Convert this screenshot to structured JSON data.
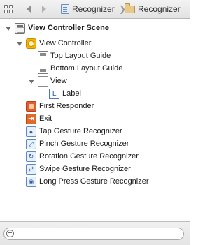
{
  "navbar": {
    "breadcrumbs": [
      {
        "label": "Recognizer",
        "icon": "project-file-icon"
      },
      {
        "label": "Recognizer",
        "icon": "folder-icon"
      }
    ],
    "chevron": "❯"
  },
  "outline": {
    "items": [
      {
        "label": "View Controller Scene",
        "icon": "scene-icon",
        "bold": true,
        "expanded": true,
        "level": 0
      },
      {
        "label": "View Controller",
        "icon": "view-controller-icon",
        "bold": false,
        "expanded": true,
        "level": 1
      },
      {
        "label": "Top Layout Guide",
        "icon": "top-layout-guide-icon",
        "level": 2
      },
      {
        "label": "Bottom Layout Guide",
        "icon": "bottom-layout-guide-icon",
        "level": 2
      },
      {
        "label": "View",
        "icon": "view-icon",
        "expanded": true,
        "level": 2
      },
      {
        "label": "Label",
        "icon": "label-icon",
        "glyph": "L",
        "level": 3
      },
      {
        "label": "First Responder",
        "icon": "first-responder-icon",
        "level": 1
      },
      {
        "label": "Exit",
        "icon": "exit-icon",
        "level": 1
      },
      {
        "label": "Tap Gesture Recognizer",
        "icon": "tap-gesture-icon",
        "level": 1
      },
      {
        "label": "Pinch Gesture Recognizer",
        "icon": "pinch-gesture-icon",
        "level": 1
      },
      {
        "label": "Rotation Gesture Recognizer",
        "icon": "rotation-gesture-icon",
        "level": 1
      },
      {
        "label": "Swipe Gesture Recognizer",
        "icon": "swipe-gesture-icon",
        "level": 1
      },
      {
        "label": "Long Press Gesture Recognizer",
        "icon": "long-press-gesture-icon",
        "level": 1
      }
    ]
  },
  "bottom": {
    "filter_icon": "filter-icon",
    "filter_value": ""
  }
}
